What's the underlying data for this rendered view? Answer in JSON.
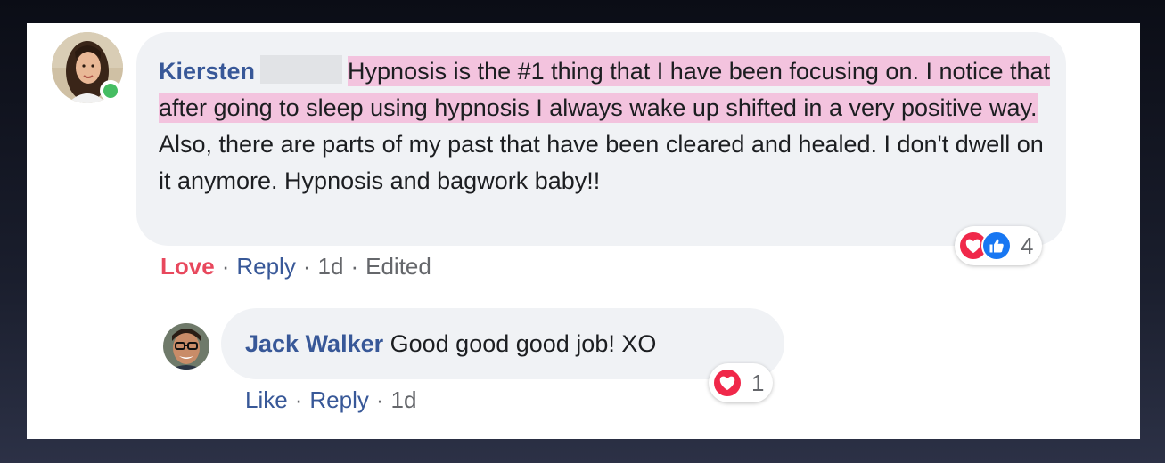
{
  "comment": {
    "author": "Kiersten",
    "text_highlighted": "Hypnosis is the #1 thing that I have been focusing on. I notice that after going to sleep using hypnosis I always wake up shifted in a very positive way.",
    "text_rest": "Also, there are parts of my past that have been cleared and healed. I don't dwell on it anymore. Hypnosis and bagwork baby!!",
    "reaction_count": "4",
    "reaction_icons": [
      "heart-icon",
      "like-icon"
    ],
    "actions": {
      "love": "Love",
      "reply": "Reply",
      "time": "1d",
      "edited": "Edited",
      "separator": "·"
    },
    "online": true
  },
  "reply": {
    "author": "Jack Walker",
    "text": "Good good good job! XO",
    "reaction_count": "1",
    "reaction_icons": [
      "heart-icon"
    ],
    "actions": {
      "like": "Like",
      "reply": "Reply",
      "time": "1d",
      "separator": "·"
    }
  },
  "colors": {
    "author_link": "#385898",
    "highlight": "#f3c3de",
    "love": "#e8485d",
    "bubble": "#f0f2f5",
    "online": "#45bd62"
  }
}
